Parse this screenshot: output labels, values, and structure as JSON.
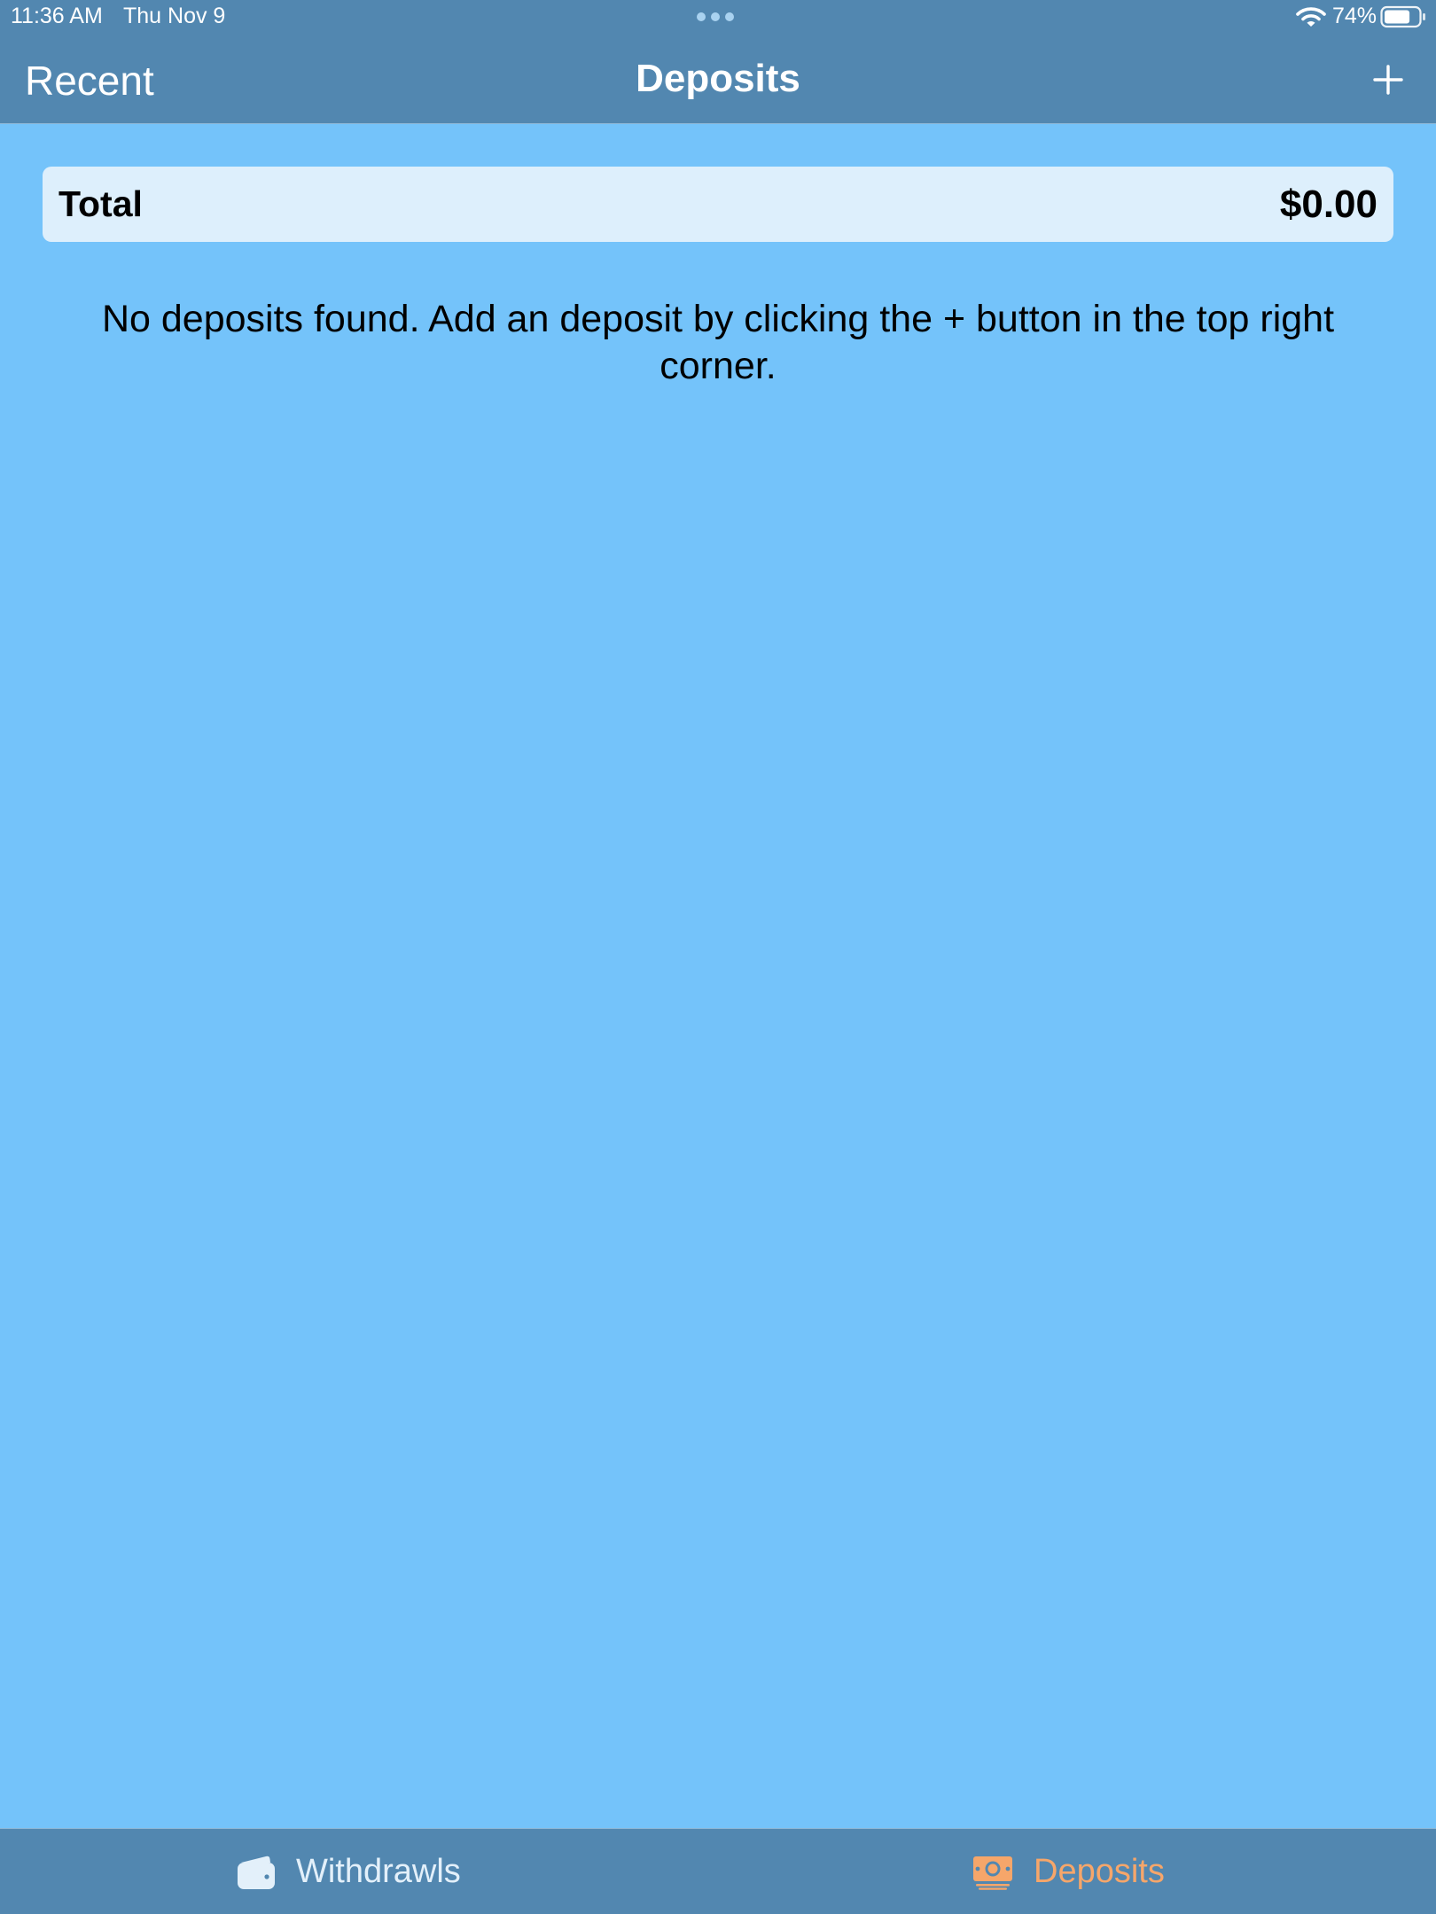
{
  "status_bar": {
    "time": "11:36 AM",
    "date": "Thu Nov 9",
    "battery_percent": "74%",
    "battery_level": 0.74,
    "icons": [
      "wifi-icon",
      "battery-icon",
      "multitask-dots-icon"
    ]
  },
  "nav": {
    "back_label": "Recent",
    "title": "Deposits",
    "add_icon": "plus-icon"
  },
  "total": {
    "label": "Total",
    "value": "$0.00"
  },
  "empty_message": "No deposits found. Add an deposit by clicking the + button in the top right corner.",
  "tabs": [
    {
      "label": "Withdrawls",
      "icon": "wallet-icon",
      "selected": false
    },
    {
      "label": "Deposits",
      "icon": "banknote-icon",
      "selected": true
    }
  ],
  "colors": {
    "background": "#74C3FA",
    "bar": "#5287B0",
    "card": "#DDEFFC",
    "selected_tab": "#F6A66A",
    "unselected_tab": "#E3F0FA"
  }
}
